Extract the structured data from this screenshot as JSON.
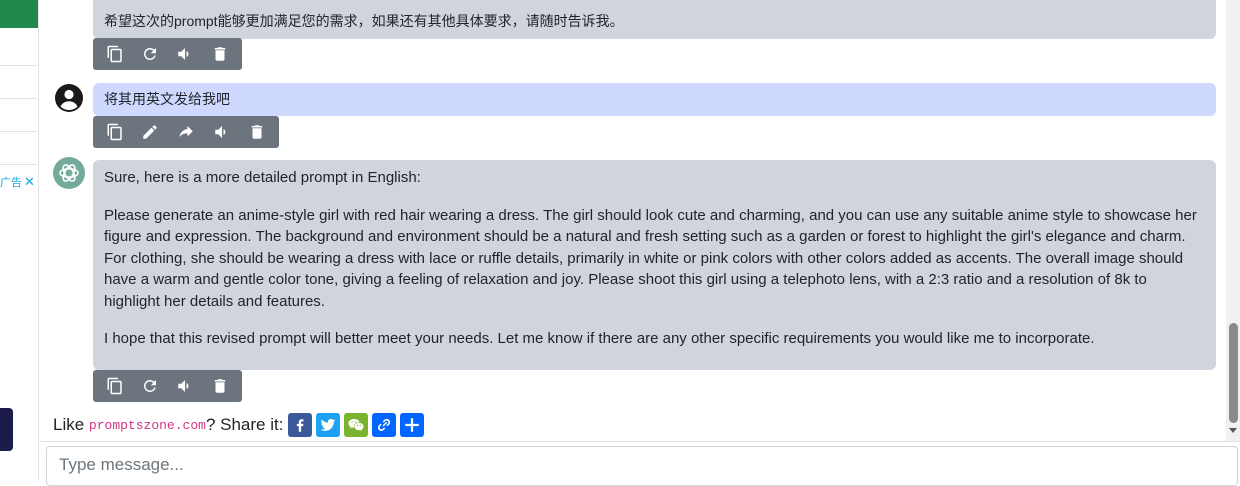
{
  "sidebar": {
    "ad_label": "广告",
    "ad_close": "✕"
  },
  "messages": [
    {
      "role": "assistant",
      "paragraphs": [
        "希望这次的prompt能够更加满足您的需求，如果还有其他具体要求，请随时告诉我。"
      ],
      "actions": [
        "copy-icon",
        "regenerate-icon",
        "speak-icon",
        "delete-icon"
      ]
    },
    {
      "role": "user",
      "paragraphs": [
        "将其用英文发给我吧"
      ],
      "actions": [
        "copy-icon",
        "edit-icon",
        "forward-icon",
        "speak-icon",
        "delete-icon"
      ]
    },
    {
      "role": "assistant",
      "paragraphs": [
        "Sure, here is a more detailed prompt in English:",
        "Please generate an anime-style girl with red hair wearing a dress. The girl should look cute and charming, and you can use any suitable anime style to showcase her figure and expression. The background and environment should be a natural and fresh setting such as a garden or forest to highlight the girl's elegance and charm. For clothing, she should be wearing a dress with lace or ruffle details, primarily in white or pink colors with other colors added as accents. The overall image should have a warm and gentle color tone, giving a feeling of relaxation and joy. Please shoot this girl using a telephoto lens, with a 2:3 ratio and a resolution of 8k to highlight her details and features.",
        "I hope that this revised prompt will better meet your needs. Let me know if there are any other specific requirements you would like me to incorporate."
      ],
      "actions": [
        "copy-icon",
        "regenerate-icon",
        "speak-icon",
        "delete-icon"
      ]
    }
  ],
  "share": {
    "prefix": "Like",
    "site": "promptszone.com",
    "suffix": "? Share it:",
    "networks": [
      {
        "name": "facebook-icon",
        "color": "#3b5998"
      },
      {
        "name": "twitter-icon",
        "color": "#1da1f2"
      },
      {
        "name": "wechat-icon",
        "color": "#7bb32e"
      },
      {
        "name": "copy-link-icon",
        "color": "#0166ff"
      },
      {
        "name": "add-share-icon",
        "color": "#0166ff"
      }
    ]
  },
  "composer": {
    "placeholder": "Type message..."
  },
  "colors": {
    "assistant_bubble": "#d0d4dc",
    "user_bubble": "#cfd9ff",
    "toolbar": "#6c757d",
    "accent_green": "#1f8a4c"
  }
}
